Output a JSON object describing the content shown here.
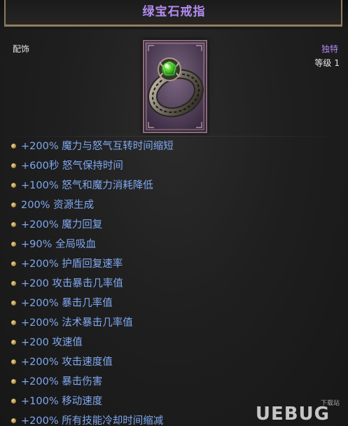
{
  "item": {
    "name": "绿宝石戒指",
    "type": "配饰",
    "rarity": "独特",
    "level_label": "等级",
    "level": "1"
  },
  "icon": {
    "name": "emerald-ring-icon",
    "colors": {
      "card": "#5a4560",
      "gem": "#3fb52a",
      "band": "#8a8478"
    }
  },
  "colors": {
    "title": "#b48cf0",
    "affix": "#7fa8f0",
    "frame": "#8e7e62",
    "background": "#1f1f1f"
  },
  "affixes": [
    "+200% 魔力与怒气互转时间缩短",
    "+600秒 怒气保持时间",
    "+100% 怒气和魔力消耗降低",
    "200% 资源生成",
    "+200% 魔力回复",
    "+90% 全局吸血",
    "+200% 护盾回复速率",
    "+200 攻击暴击几率值",
    "+200% 暴击几率值",
    "+200% 法术暴击几率值",
    "+200 攻速值",
    "+200% 攻击速度值",
    "+200% 暴击伤害",
    "+100% 移动速度",
    "+200% 所有技能冷却时间缩减"
  ],
  "watermark": {
    "text": "UEBUG",
    "small": "下载站"
  }
}
